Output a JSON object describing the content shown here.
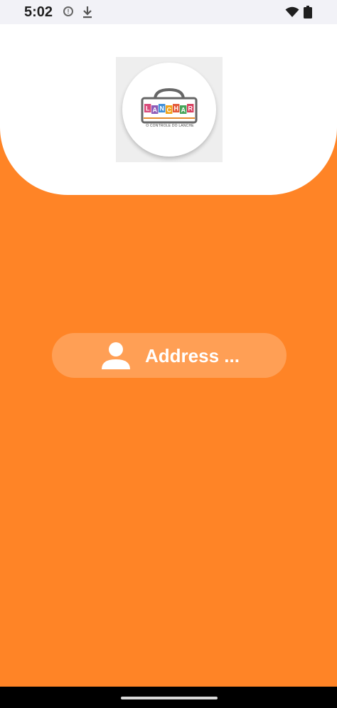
{
  "status_bar": {
    "time": "5:02",
    "icons": [
      "alert-icon",
      "download-icon",
      "wifi-icon",
      "battery-icon"
    ]
  },
  "logo": {
    "letters": [
      "L",
      "A",
      "N",
      "C",
      "H",
      "A",
      "R"
    ],
    "tagline": "O CONTROLE DO LANCHE",
    "letter_colors": [
      "#D94A7A",
      "#8E5BB8",
      "#3F8FD9",
      "#F2A31B",
      "#E35A3B",
      "#46A55A",
      "#D93F5F"
    ]
  },
  "address_field": {
    "placeholder": "Address ...",
    "icon": "person-icon"
  },
  "colors": {
    "background": "#FF8426",
    "panel": "#FFFFFF"
  }
}
